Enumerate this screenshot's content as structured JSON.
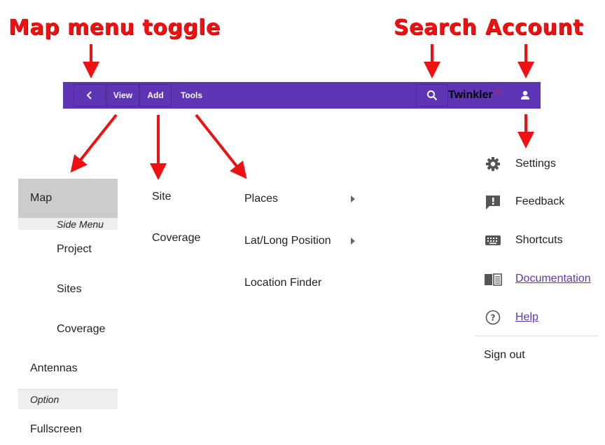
{
  "annotations": {
    "map_menu_toggle": "Map menu toggle",
    "search": "Search",
    "account": "Account"
  },
  "colors": {
    "toolbar": "#5d35b5",
    "annotation": "#ee1111",
    "selected": "#cccccc",
    "header": "#eeeeee"
  },
  "toolbar": {
    "back_icon": "chevron-left-icon",
    "view_label": "View",
    "add_label": "Add",
    "tools_label": "Tools",
    "search_icon": "search-icon",
    "app_name": "Twinkler",
    "app_star": "☆",
    "account_icon": "person-icon"
  },
  "view_menu": {
    "selected": "Map",
    "side_menu_header": "Side Menu",
    "items": [
      "Project",
      "Sites",
      "Coverage"
    ],
    "antennas": "Antennas",
    "option_header": "Option",
    "fullscreen": "Fullscreen"
  },
  "add_menu": {
    "items": [
      "Site",
      "Coverage"
    ]
  },
  "tools_menu": {
    "places": "Places",
    "latlong": "Lat/Long Position",
    "location_finder": "Location Finder"
  },
  "account_menu": {
    "settings": "Settings",
    "feedback": "Feedback",
    "shortcuts": "Shortcuts",
    "documentation": "Documentation",
    "help": "Help",
    "sign_out": "Sign out"
  }
}
